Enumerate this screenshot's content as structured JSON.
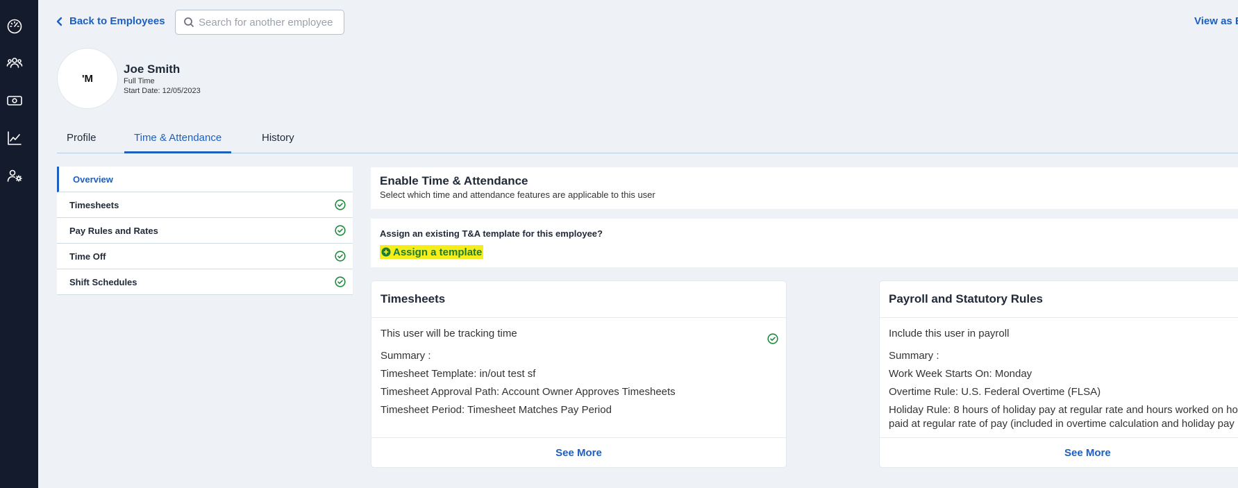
{
  "sidebar": {
    "icons": [
      "dashboard-gauge-icon",
      "people-icon",
      "money-icon",
      "chart-icon",
      "user-settings-icon"
    ]
  },
  "header": {
    "back_label": "Back to Employees",
    "search_placeholder": "Search for another employee",
    "view_as_label": "View as E"
  },
  "employee": {
    "avatar_initials": "'M",
    "name": "Joe Smith",
    "type": "Full Time",
    "start_date": "Start Date: 12/05/2023"
  },
  "tabs": [
    {
      "label": "Profile",
      "active": false
    },
    {
      "label": "Time & Attendance",
      "active": true
    },
    {
      "label": "History",
      "active": false
    }
  ],
  "subnav": [
    {
      "label": "Overview",
      "active": true,
      "checked": false
    },
    {
      "label": "Timesheets",
      "active": false,
      "checked": true
    },
    {
      "label": "Pay Rules and Rates",
      "active": false,
      "checked": true
    },
    {
      "label": "Time Off",
      "active": false,
      "checked": true
    },
    {
      "label": "Shift Schedules",
      "active": false,
      "checked": true
    }
  ],
  "enable": {
    "title": "Enable Time & Attendance",
    "subtitle": "Select which time and attendance features are applicable to this user"
  },
  "assign": {
    "question": "Assign an existing T&A template for this employee?",
    "button_label": "Assign a template"
  },
  "timesheets_card": {
    "title": "Timesheets",
    "tracking": "This user will be tracking time",
    "summary_label": "Summary :",
    "lines": [
      "Timesheet Template: in/out test sf",
      "Timesheet Approval Path: Account Owner Approves Timesheets",
      "Timesheet Period: Timesheet Matches Pay Period"
    ],
    "see_more": "See More"
  },
  "payroll_card": {
    "title": "Payroll and Statutory Rules",
    "include": "Include this user in payroll",
    "summary_label": "Summary :",
    "lines": [
      "Work Week Starts On: Monday",
      "Overtime Rule: U.S. Federal Overtime (FLSA)",
      "Holiday Rule: 8 hours of holiday pay at regular rate and hours worked on ho",
      "paid at regular rate of pay (included in overtime calculation and holiday pay"
    ],
    "see_more": "See More"
  },
  "colors": {
    "sidebar_bg": "#141b2d",
    "page_bg": "#eef2f7",
    "accent_blue": "#1d5fbf",
    "check_green": "#1e8a3e",
    "highlight_yellow": "#f5ee1b"
  }
}
